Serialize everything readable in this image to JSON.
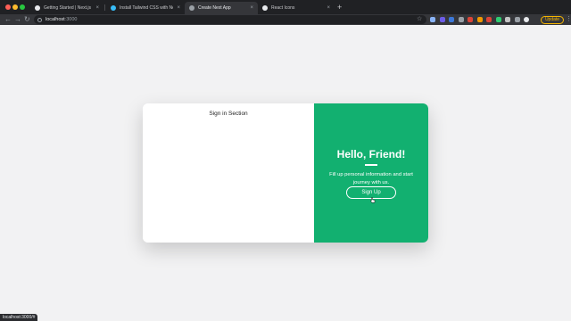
{
  "browser": {
    "tabs": [
      {
        "label": "Getting Started | Next.js",
        "favicon_color": "#e8eaed",
        "active": false
      },
      {
        "label": "Install Tailwind CSS with Next.js",
        "favicon_color": "#38bdf8",
        "active": false
      },
      {
        "label": "Create Next App",
        "favicon_color": "#e8eaed",
        "active": true
      },
      {
        "label": "React Icons",
        "favicon_color": "#e8eaed",
        "active": false
      }
    ],
    "new_tab_symbol": "+",
    "close_symbol": "×",
    "address": {
      "host": "localhost",
      "port": ":3000"
    },
    "update_label": "Update",
    "extension_colors": [
      "#8ab4f8",
      "#6c5ce7",
      "#3c78d8",
      "#9aa0a6",
      "#db4437",
      "#f29900",
      "#db4437",
      "#2ecc71",
      "#c5c5c5",
      "#9aa0a6",
      "#e8eaed"
    ]
  },
  "page": {
    "signin": {
      "title": "Sign in Section"
    },
    "signup": {
      "heading": "Hello, Friend!",
      "description": "Fill up personal information and start journey with us.",
      "button_label": "Sign Up"
    }
  },
  "status_bar": {
    "text": "localhost:3000/#"
  },
  "colors": {
    "accent": "#12b070",
    "card": "#ffffff",
    "background": "#f2f2f3"
  }
}
